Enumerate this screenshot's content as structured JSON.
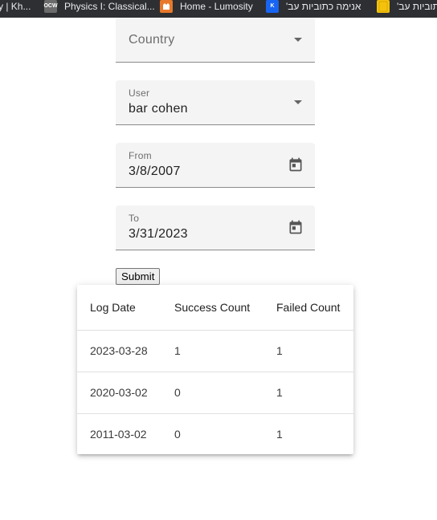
{
  "bookmarks": [
    {
      "label": "y | Kh...",
      "icon": "none"
    },
    {
      "label": "Physics I: Classical...",
      "icon": "mit-ocw-icon"
    },
    {
      "label": "Home - Lumosity",
      "icon": "lumosity-icon"
    },
    {
      "label": "אנימה כתוביות עב'",
      "icon": "k-icon"
    },
    {
      "label": "כתוביות עב'",
      "icon": "folder-doc-icon"
    }
  ],
  "form": {
    "country": {
      "placeholder": "Country"
    },
    "user": {
      "label": "User",
      "value": "bar cohen"
    },
    "from": {
      "label": "From",
      "value": "3/8/2007"
    },
    "to": {
      "label": "To",
      "value": "3/31/2023"
    },
    "submit_label": "Submit"
  },
  "table": {
    "headers": [
      "Log Date",
      "Success Count",
      "Failed Count"
    ],
    "rows": [
      [
        "2023-03-28",
        "1",
        "1"
      ],
      [
        "2020-03-02",
        "0",
        "1"
      ],
      [
        "2011-03-02",
        "0",
        "1"
      ]
    ]
  },
  "colors": {
    "bookmarks_bar": "#2e2f32",
    "field_background": "#f4f4f4",
    "lumosity": "#e8792b",
    "khan_blue": "#1865f2"
  }
}
